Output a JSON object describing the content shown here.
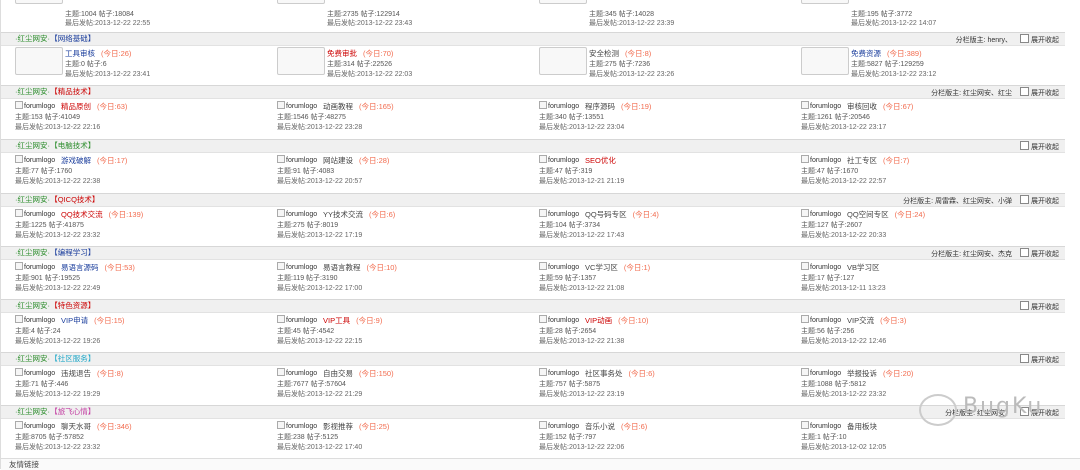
{
  "colors": {
    "today": "#f26c4f",
    "red_title": "#c00",
    "blue_title": "#1a3d9c",
    "green_title": "#2a8c2a",
    "cyan_title": "#22a9c9",
    "pink_title": "#c23aa0"
  },
  "top_partial": [
    {
      "stats": "主题:1004  帖子:18084",
      "last": "最后发帖:2013-12-22 22:55"
    },
    {
      "stats": "主题:2735  帖子:122914",
      "last": "最后发帖:2013-12-22 23:43"
    },
    {
      "stats": "主题:345  帖子:14028",
      "last": "最后发帖:2013-12-22 23:39"
    },
    {
      "stats": "主题:195  帖子:3772",
      "last": "最后发帖:2013-12-22 14:07"
    }
  ],
  "sections": [
    {
      "title_prefix": "·红尘网安·",
      "title": "【网络基础】",
      "title_color": "#1a3d9c",
      "right": "分栏版主: henry、",
      "toggle": "展开收起",
      "forums": [
        {
          "name": "工具审核",
          "today": "(今日:26)",
          "stats": "主题:0  帖子:6",
          "last": "最后发帖:2013-12-22 23:41",
          "name_color": "#1a3d9c"
        },
        {
          "name": "免费审批",
          "today": "(今日:70)",
          "stats": "主题:314  帖子:22526",
          "last": "最后发帖:2013-12-22 22:03",
          "name_color": "#c00"
        },
        {
          "name": "安全检测",
          "today": "(今日:8)",
          "stats": "主题:275  帖子:7236",
          "last": "最后发帖:2013-12-22 23:26",
          "name_color": "#444"
        },
        {
          "name": "免费资源",
          "today": "(今日:389)",
          "stats": "主题:5827  帖子:129259",
          "last": "最后发帖:2013-12-22 23:12",
          "name_color": "#1a3d9c"
        }
      ]
    },
    {
      "title_prefix": "·红尘网安·",
      "title": "【精品技术】",
      "title_color": "#c00",
      "right": "分栏版主: 红尘网安、红尘",
      "toggle": "展开收起",
      "forums": [
        {
          "name": "精品原创",
          "today": "(今日:63)",
          "stats": "主题:153  帖子:41049",
          "last": "最后发帖:2013-12-22 22:16",
          "name_color": "#c00"
        },
        {
          "name": "动画教程",
          "today": "(今日:165)",
          "stats": "主题:1546  帖子:48275",
          "last": "最后发帖:2013-12-22 23:28",
          "name_color": "#444"
        },
        {
          "name": "程序源码",
          "today": "(今日:19)",
          "stats": "主题:340  帖子:13551",
          "last": "最后发帖:2013-12-22 23:04",
          "name_color": "#444"
        },
        {
          "name": "审核回收",
          "today": "(今日:67)",
          "stats": "主题:1261  帖子:20546",
          "last": "最后发帖:2013-12-22 23:17",
          "name_color": "#444"
        }
      ]
    },
    {
      "title_prefix": "·红尘网安·",
      "title": "【电脑技术】",
      "title_color": "#2a8c2a",
      "right": "",
      "toggle": "展开收起",
      "forums": [
        {
          "name": "游戏破解",
          "today": "(今日:17)",
          "stats": "主题:77  帖子:1760",
          "last": "最后发帖:2013-12-22 22:38",
          "name_color": "#1a3d9c"
        },
        {
          "name": "网站建设",
          "today": "(今日:28)",
          "stats": "主题:91  帖子:4083",
          "last": "最后发帖:2013-12-22 20:57",
          "name_color": "#444"
        },
        {
          "name": "SEO优化",
          "today": "",
          "stats": "主题:47  帖子:319",
          "last": "最后发帖:2013-12-21 21:19",
          "name_color": "#c00"
        },
        {
          "name": "社工专区",
          "today": "(今日:7)",
          "stats": "主题:47  帖子:1670",
          "last": "最后发帖:2013-12-22 22:57",
          "name_color": "#444"
        }
      ]
    },
    {
      "title_prefix": "·红尘网安·",
      "title": "【QICQ技术】",
      "title_color": "#c00",
      "right": "分栏版主: 周雷霖、红尘网安、小弹",
      "toggle": "展开收起",
      "forums": [
        {
          "name": "QQ技术交流",
          "today": "(今日:139)",
          "stats": "主题:1225  帖子:41875",
          "last": "最后发帖:2013-12-22 23:32",
          "name_color": "#c00"
        },
        {
          "name": "YY技术交流",
          "today": "(今日:6)",
          "stats": "主题:275  帖子:8019",
          "last": "最后发帖:2013-12-22 17:19",
          "name_color": "#444"
        },
        {
          "name": "QQ号码专区",
          "today": "(今日:4)",
          "stats": "主题:104  帖子:3734",
          "last": "最后发帖:2013-12-22 17:43",
          "name_color": "#444"
        },
        {
          "name": "QQ空间专区",
          "today": "(今日:24)",
          "stats": "主题:127  帖子:2607",
          "last": "最后发帖:2013-12-22 20:33",
          "name_color": "#444"
        }
      ]
    },
    {
      "title_prefix": "·红尘网安·",
      "title": "【编程学习】",
      "title_color": "#1a3d9c",
      "right": "分栏版主: 红尘网安、杰克",
      "toggle": "展开收起",
      "forums": [
        {
          "name": "易语言源码",
          "today": "(今日:53)",
          "stats": "主题:901  帖子:19525",
          "last": "最后发帖:2013-12-22 22:49",
          "name_color": "#1a3d9c"
        },
        {
          "name": "易语言教程",
          "today": "(今日:10)",
          "stats": "主题:119  帖子:3190",
          "last": "最后发帖:2013-12-22 17:00",
          "name_color": "#444"
        },
        {
          "name": "VC学习区",
          "today": "(今日:1)",
          "stats": "主题:59  帖子:1357",
          "last": "最后发帖:2013-12-22 21:08",
          "name_color": "#444"
        },
        {
          "name": "VB学习区",
          "today": "",
          "stats": "主题:17  帖子:127",
          "last": "最后发帖:2013-12-11 13:23",
          "name_color": "#444"
        }
      ]
    },
    {
      "title_prefix": "·红尘网安·",
      "title": "【特色资源】",
      "title_color": "#c00",
      "right": "",
      "toggle": "展开收起",
      "forums": [
        {
          "name": "VIP申请",
          "today": "(今日:15)",
          "stats": "主题:4  帖子:24",
          "last": "最后发帖:2013-12-22 19:26",
          "name_color": "#1a3d9c"
        },
        {
          "name": "VIP工具",
          "today": "(今日:9)",
          "stats": "主题:45  帖子:4542",
          "last": "最后发帖:2013-12-22 22:15",
          "name_color": "#c00"
        },
        {
          "name": "VIP动画",
          "today": "(今日:10)",
          "stats": "主题:28  帖子:2654",
          "last": "最后发帖:2013-12-22 21:38",
          "name_color": "#c00"
        },
        {
          "name": "VIP交流",
          "today": "(今日:3)",
          "stats": "主题:56  帖子:256",
          "last": "最后发帖:2013-12-22 12:46",
          "name_color": "#444"
        }
      ]
    },
    {
      "title_prefix": "·红尘网安·",
      "title": "【社区服务】",
      "title_color": "#22a9c9",
      "right": "",
      "toggle": "展开收起",
      "forums": [
        {
          "name": "违规退告",
          "today": "(今日:8)",
          "stats": "主题:71  帖子:446",
          "last": "最后发帖:2013-12-22 19:29",
          "name_color": "#444"
        },
        {
          "name": "自由交易",
          "today": "(今日:150)",
          "stats": "主题:7677  帖子:57604",
          "last": "最后发帖:2013-12-22 21:29",
          "name_color": "#444"
        },
        {
          "name": "社区事务处",
          "today": "(今日:6)",
          "stats": "主题:757  帖子:5875",
          "last": "最后发帖:2013-12-22 23:19",
          "name_color": "#444"
        },
        {
          "name": "举报投诉",
          "today": "(今日:20)",
          "stats": "主题:1088  帖子:5812",
          "last": "最后发帖:2013-12-22 23:32",
          "name_color": "#444"
        }
      ]
    },
    {
      "title_prefix": "·红尘网安·",
      "title": "【旅飞心情】",
      "title_color": "#c23aa0",
      "right": "分栏版主: 红尘网安、",
      "toggle": "展开收起",
      "forums": [
        {
          "name": "聊天水哥",
          "today": "(今日:346)",
          "stats": "主题:8705  帖子:57852",
          "last": "最后发帖:2013-12-22 23:32",
          "name_color": "#444"
        },
        {
          "name": "影视推荐",
          "today": "(今日:25)",
          "stats": "主题:238  帖子:5125",
          "last": "最后发帖:2013-12-22 17:40",
          "name_color": "#444"
        },
        {
          "name": "音乐小说",
          "today": "(今日:6)",
          "stats": "主题:152  帖子:797",
          "last": "最后发帖:2013-12-22 22:06",
          "name_color": "#444"
        },
        {
          "name": "备用板块",
          "today": "",
          "stats": "主题:1  帖子:10",
          "last": "最后发帖:2013-12-02 12:05",
          "name_color": "#444"
        }
      ]
    }
  ],
  "logo_text": "forumlogo",
  "watermark": "BugKu",
  "footer": "友情链接"
}
